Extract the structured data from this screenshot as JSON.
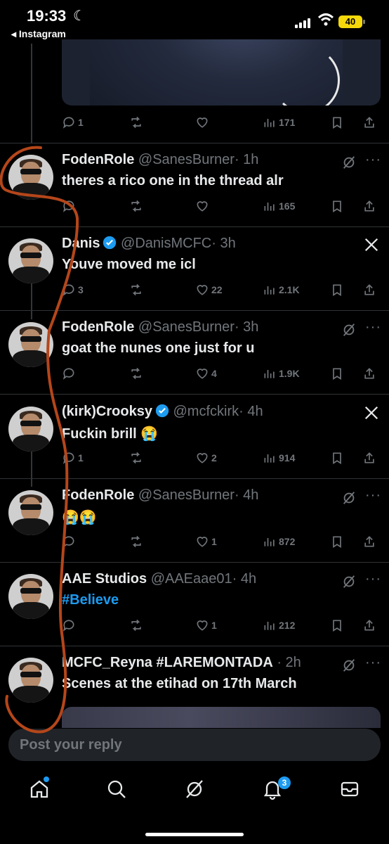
{
  "status_bar": {
    "time": "19:33",
    "back_app": "Instagram",
    "battery": "40"
  },
  "first_actions": {
    "replies": "1",
    "retweets": "",
    "likes": "",
    "views": "171"
  },
  "tweets": [
    {
      "name": "FodenRole",
      "handle": "@SanesBurner",
      "time": "· 1h",
      "text": "theres a rico one in the thread alr",
      "verified": false,
      "badge": "grok",
      "replies": "",
      "retweets": "",
      "likes": "",
      "views": "165"
    },
    {
      "name": "Danis",
      "handle": "@DanisMCFC",
      "time": "· 3h",
      "text": "Youve moved me icl",
      "verified": true,
      "badge": "x",
      "replies": "3",
      "retweets": "",
      "likes": "22",
      "views": "2.1K"
    },
    {
      "name": "FodenRole",
      "handle": "@SanesBurner",
      "time": "· 3h",
      "text": "goat the nunes one just for u",
      "verified": false,
      "badge": "grok",
      "replies": "",
      "retweets": "",
      "likes": "4",
      "views": "1.9K"
    },
    {
      "name": "(kirk)Crooksy",
      "handle": "@mcfckirk",
      "time": "· 4h",
      "text": "Fuckin brill 😭",
      "verified": true,
      "badge": "x",
      "replies": "1",
      "retweets": "",
      "likes": "2",
      "views": "914"
    },
    {
      "name": "FodenRole",
      "handle": "@SanesBurner",
      "time": "· 4h",
      "text": "😭😭",
      "verified": false,
      "badge": "grok",
      "replies": "",
      "retweets": "",
      "likes": "1",
      "views": "872"
    },
    {
      "name": "AAE Studios",
      "handle": "@AAEaae01",
      "time": "· 4h",
      "text": "#Believe",
      "verified": false,
      "badge": "grok",
      "replies": "",
      "retweets": "",
      "likes": "1",
      "views": "212"
    },
    {
      "name": "MCFC_Reyna #LAREMONTADA",
      "handle": "",
      "time": "· 2h",
      "text": "Scenes at the etihad on 17th March",
      "verified": false,
      "badge": "grok"
    }
  ],
  "reply_placeholder": "Post your reply",
  "notifications_badge": "3",
  "colors": {
    "accent": "#1d9bf0",
    "muted": "#71767b",
    "annotation": "#b5461a"
  }
}
